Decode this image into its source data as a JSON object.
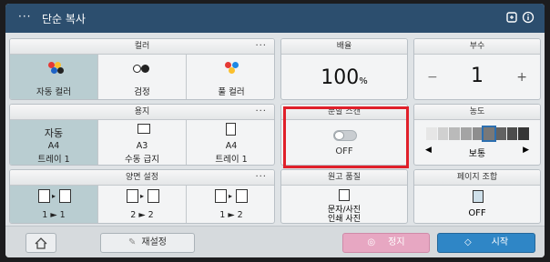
{
  "titlebar": {
    "menu_icon": "···",
    "title": "단순 복사",
    "icons": [
      "settings-sync-icon",
      "info-icon"
    ]
  },
  "color": {
    "header": "컬러",
    "options": [
      {
        "label": "자동 컬러",
        "selected": true
      },
      {
        "label": "검정",
        "selected": false
      },
      {
        "label": "풀 컬러",
        "selected": false
      }
    ]
  },
  "zoom": {
    "header": "배율",
    "value": "100",
    "unit": "%"
  },
  "copies": {
    "header": "부수",
    "value": "1",
    "minus": "−",
    "plus": "+"
  },
  "paper": {
    "header": "용지",
    "options": [
      {
        "line1": "자동",
        "line2": "A4",
        "line3": "트레이 1",
        "selected": true
      },
      {
        "line1": "A3",
        "line2": "수동 급지",
        "selected": false
      },
      {
        "line1": "A4",
        "line2": "트레이 1",
        "selected": false
      }
    ]
  },
  "split_scan": {
    "header": "분할 스캔",
    "status": "OFF"
  },
  "density": {
    "header": "농도",
    "left": "◀",
    "label": "보통",
    "right": "▶",
    "level_index": 5,
    "levels": 9
  },
  "duplex": {
    "header": "양면 설정",
    "options": [
      {
        "label": "1 ► 1",
        "selected": true
      },
      {
        "label": "2 ► 2",
        "selected": false
      },
      {
        "label": "1 ► 2",
        "selected": false
      }
    ]
  },
  "quality": {
    "header": "원고 품질",
    "line1": "문자/사진",
    "line2": "인쇄 사진"
  },
  "combine": {
    "header": "페이지 조합",
    "status": "OFF"
  },
  "bottom": {
    "reset": "재설정",
    "stop": "정지",
    "start": "시작"
  },
  "colors": {
    "titlebar": "#2c4e6e",
    "selected": "#b9cdd1",
    "stop": "#e7a7c2",
    "start": "#2f86c6",
    "highlight": "#e0202a"
  }
}
